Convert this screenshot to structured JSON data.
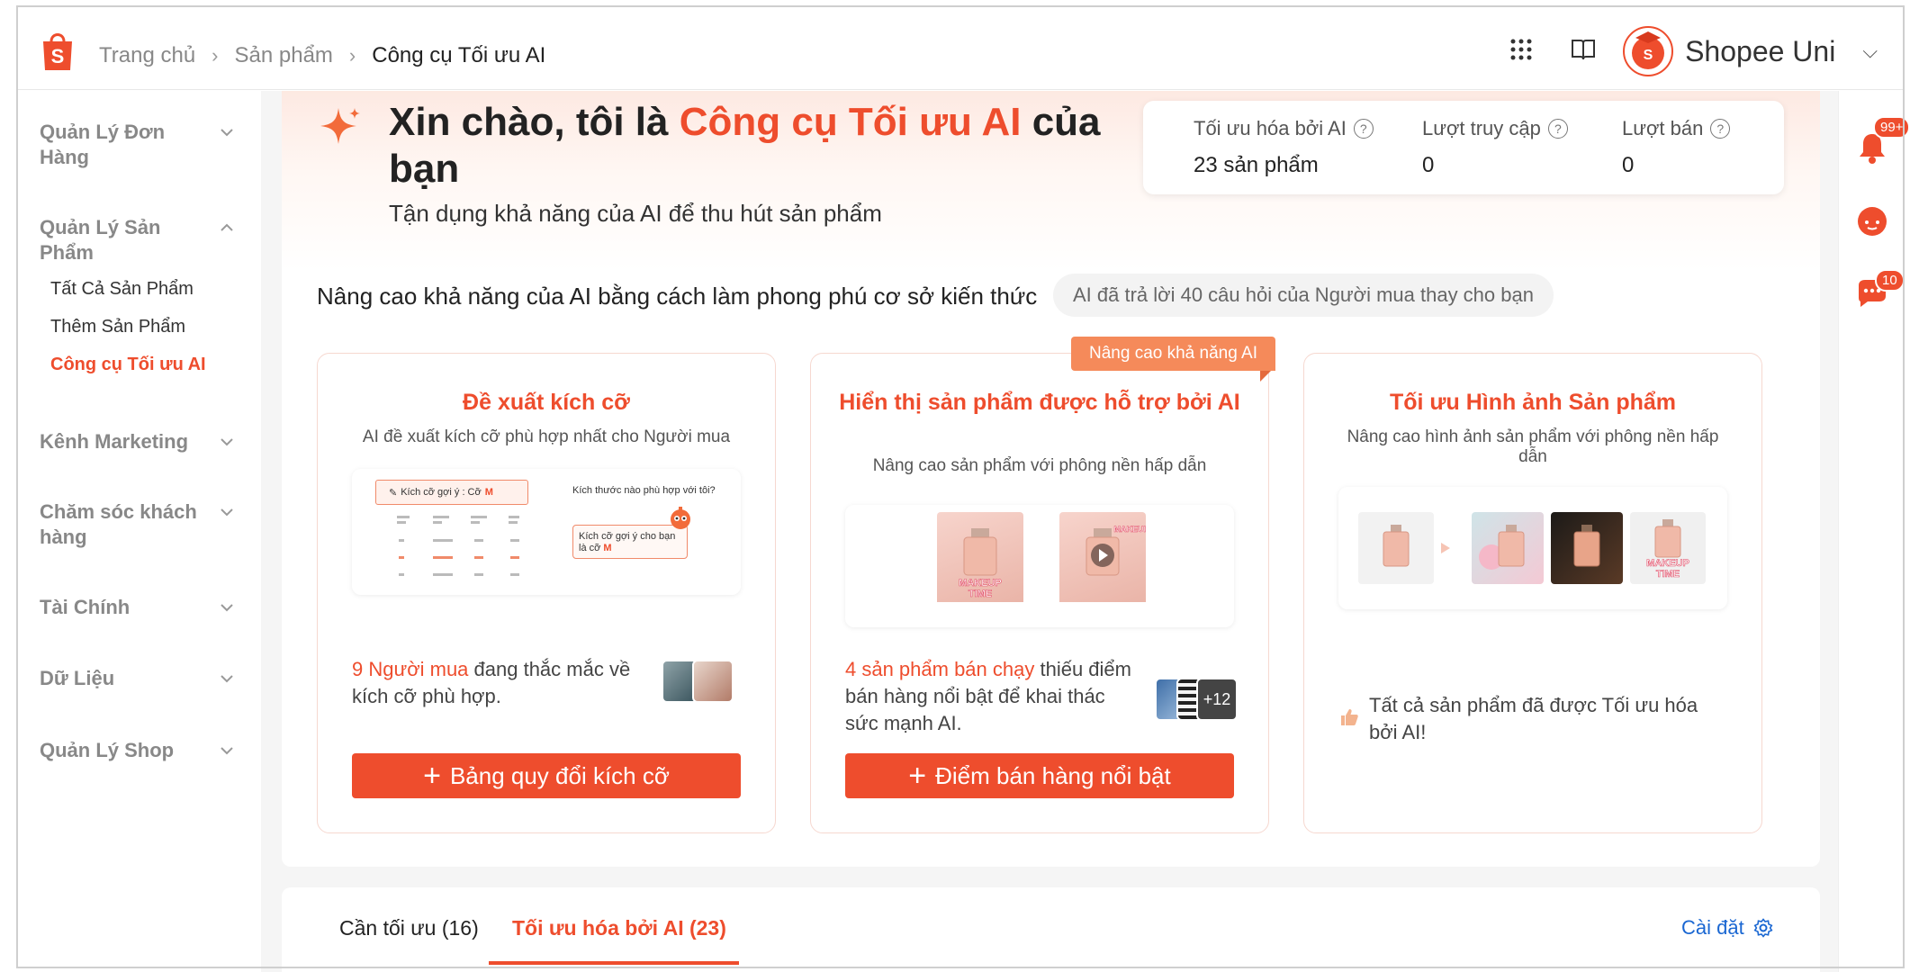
{
  "header": {
    "breadcrumb": [
      "Trang chủ",
      "Sản phẩm",
      "Công cụ Tối ưu AI"
    ],
    "account_name": "Shopee Uni"
  },
  "sidebar": {
    "groups": [
      {
        "title": "Quản Lý Đơn Hàng",
        "expanded": false
      },
      {
        "title": "Quản Lý Sản Phẩm",
        "expanded": true,
        "items": [
          "Tất Cả Sản Phẩm",
          "Thêm Sản Phẩm",
          "Công cụ Tối ưu AI"
        ],
        "active_item": "Công cụ Tối ưu AI"
      },
      {
        "title": "Kênh Marketing",
        "expanded": false
      },
      {
        "title": "Chăm sóc khách hàng",
        "expanded": false
      },
      {
        "title": "Tài Chính",
        "expanded": false
      },
      {
        "title": "Dữ Liệu",
        "expanded": false
      },
      {
        "title": "Quản Lý Shop",
        "expanded": false
      }
    ]
  },
  "hero": {
    "title_prefix": "Xin chào, tôi là ",
    "title_accent": "Công cụ Tối ưu AI",
    "title_suffix": " của bạn",
    "subtitle": "Tận dụng khả năng của AI để thu hút sản phẩm"
  },
  "stats": [
    {
      "label": "Tối ưu hóa bởi AI",
      "value": "23 sản phẩm"
    },
    {
      "label": "Lượt truy cập",
      "value": "0"
    },
    {
      "label": "Lượt bán",
      "value": "0"
    }
  ],
  "knowledge": {
    "title": "Nâng cao khả năng của AI bằng cách làm phong phú cơ sở kiến thức",
    "pill": "AI đã trả lời 40 câu hỏi của Người mua thay cho bạn"
  },
  "cards": [
    {
      "title": "Đề xuất kích cỡ",
      "desc": "AI đề xuất kích cỡ phù hợp nhất cho Người mua",
      "preview": {
        "size_tag": "Kích cỡ gợi ý : Cỡ",
        "size_val": "M",
        "question": "Kích thước nào phù hợp với tôi?",
        "answer": "Kích cỡ gợi ý cho bạn là cỡ",
        "answer_val": "M"
      },
      "note_highlight": "9 Người mua",
      "note_text": " đang thắc mắc về kích cỡ phù hợp.",
      "button": "Bảng quy đổi kích cỡ"
    },
    {
      "title": "Hiển thị sản phẩm được hỗ trợ bởi AI",
      "desc": "Nâng cao sản phẩm với phông nền hấp dẫn",
      "ribbon": "Nâng cao khả năng AI",
      "preview_label": "MAKEUP TIME",
      "note_highlight": "4 sản phẩm bán chạy",
      "note_text": " thiếu điểm bán hàng nổi bật để khai thác sức mạnh AI.",
      "more_count": "+12",
      "button": "Điểm bán hàng nổi bật"
    },
    {
      "title": "Tối ưu Hình ảnh Sản phẩm",
      "desc": "Nâng cao hình ảnh sản phẩm với phông nền hấp dẫn",
      "preview_label": "MAKEUP TIME",
      "note_text": "Tất cả sản phẩm đã được Tối ưu hóa bởi AI!"
    }
  ],
  "tabs": [
    {
      "label": "Cần tối ưu (16)",
      "active": false
    },
    {
      "label": "Tối ưu hóa bởi AI (23)",
      "active": true
    }
  ],
  "settings_label": "Cài đặt",
  "rail": {
    "notif_badge": "99+",
    "chat_badge": "10"
  },
  "colors": {
    "accent": "#ee4d2d",
    "link": "#1a67d2",
    "ribbon": "#f58a5a"
  }
}
